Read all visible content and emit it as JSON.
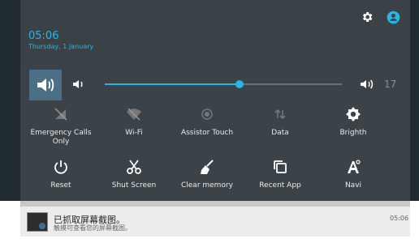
{
  "status": {
    "time": "05:06",
    "date": "Thursday, 1 January"
  },
  "header_icons": [
    "gear-icon",
    "account-icon"
  ],
  "volume": {
    "value_label": "17",
    "level": 0.57
  },
  "tiles_row1": [
    {
      "label": "Emergency Calls\nOnly",
      "icon": "signal-off-icon"
    },
    {
      "label": "Wi-Fi",
      "icon": "wifi-off-icon"
    },
    {
      "label": "Assistor Touch",
      "icon": "touch-dot-icon"
    },
    {
      "label": "Data",
      "icon": "data-arrows-icon"
    },
    {
      "label": "Brighth",
      "icon": "brightness-icon"
    }
  ],
  "tiles_row2": [
    {
      "label": "Reset",
      "icon": "power-icon"
    },
    {
      "label": "Shut Screen",
      "icon": "scissors-icon"
    },
    {
      "label": "Clear memory",
      "icon": "broom-icon"
    },
    {
      "label": "Recent App",
      "icon": "recent-apps-icon"
    },
    {
      "label": "Navi",
      "icon": "navigation-icon"
    }
  ],
  "notification": {
    "title": "已抓取屏幕截图。",
    "subtitle": "触摸可查看您的屏幕截图。",
    "time": "05:06"
  },
  "colors": {
    "accent": "#26b6e8",
    "panel": "#3b4348",
    "header": "#3a4247"
  }
}
